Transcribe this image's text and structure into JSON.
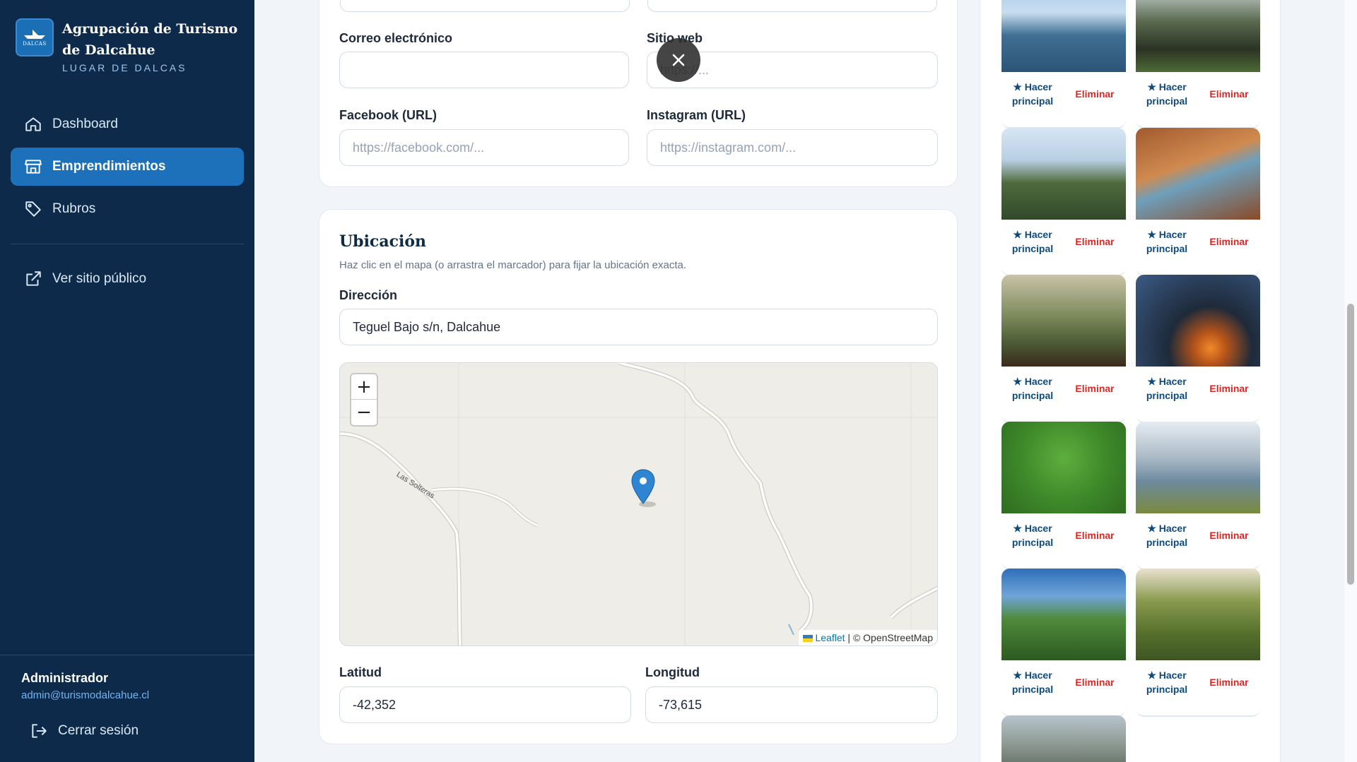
{
  "brand": {
    "title": "Agrupación de Turismo de Dalcahue",
    "subtitle": "LUGAR DE DALCAS",
    "logo_text": "DALCAS"
  },
  "nav": {
    "dashboard": "Dashboard",
    "emprendimientos": "Emprendimientos",
    "rubros": "Rubros",
    "public_site": "Ver sitio público"
  },
  "user": {
    "name": "Administrador",
    "email": "admin@turismodalcahue.cl",
    "logout": "Cerrar sesión"
  },
  "contact": {
    "email_label": "Correo electrónico",
    "email_value": "",
    "website_label": "Sitio web",
    "website_placeholder": "https://...",
    "facebook_label": "Facebook (URL)",
    "facebook_placeholder": "https://facebook.com/...",
    "instagram_label": "Instagram (URL)",
    "instagram_placeholder": "https://instagram.com/..."
  },
  "location": {
    "title": "Ubicación",
    "help": "Haz clic en el mapa (o arrastra el marcador) para fijar la ubicación exacta.",
    "address_label": "Dirección",
    "address_value": "Teguel Bajo s/n, Dalcahue",
    "map": {
      "zoom_in": "+",
      "zoom_out": "−",
      "street_label": "Las Solteras",
      "attribution_leaflet": "Leaflet",
      "attribution_rest": " | © OpenStreetMap"
    },
    "lat_label": "Latitud",
    "lat_value": "-42,352",
    "lng_label": "Longitud",
    "lng_value": "-73,615"
  },
  "gallery": {
    "make_main": "★ Hacer principal",
    "delete": "Eliminar"
  },
  "colors": {
    "sidebar": "#0d2a4b",
    "active": "#1d70ba",
    "danger": "#dc2626",
    "link": "#0f4a7d"
  }
}
